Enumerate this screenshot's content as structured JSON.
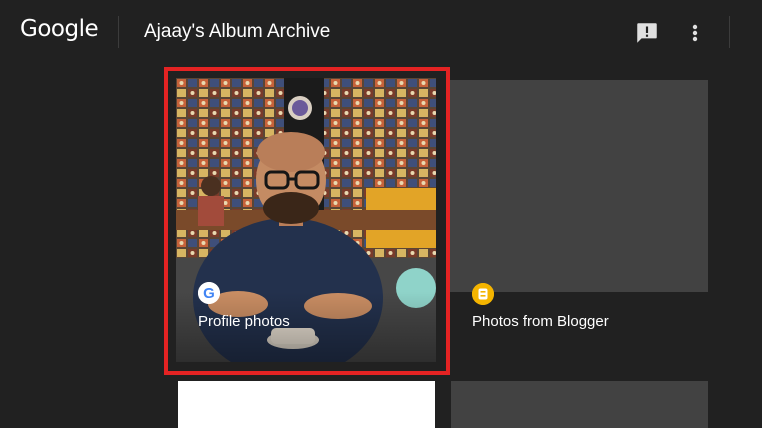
{
  "header": {
    "logo_text": "Google",
    "title": "Ajaay's Album Archive",
    "feedback_icon": "feedback-icon",
    "more_icon": "more-vert-icon"
  },
  "albums": [
    {
      "label": "Profile photos",
      "badge_icon": "google-g-icon",
      "selected": true
    },
    {
      "label": "Photos from Blogger",
      "badge_icon": "blogger-icon",
      "selected": false
    }
  ],
  "colors": {
    "background": "#212121",
    "card": "#424242",
    "selection": "#e42323",
    "blogger": "#f4b400",
    "google_blue": "#4285f4"
  }
}
